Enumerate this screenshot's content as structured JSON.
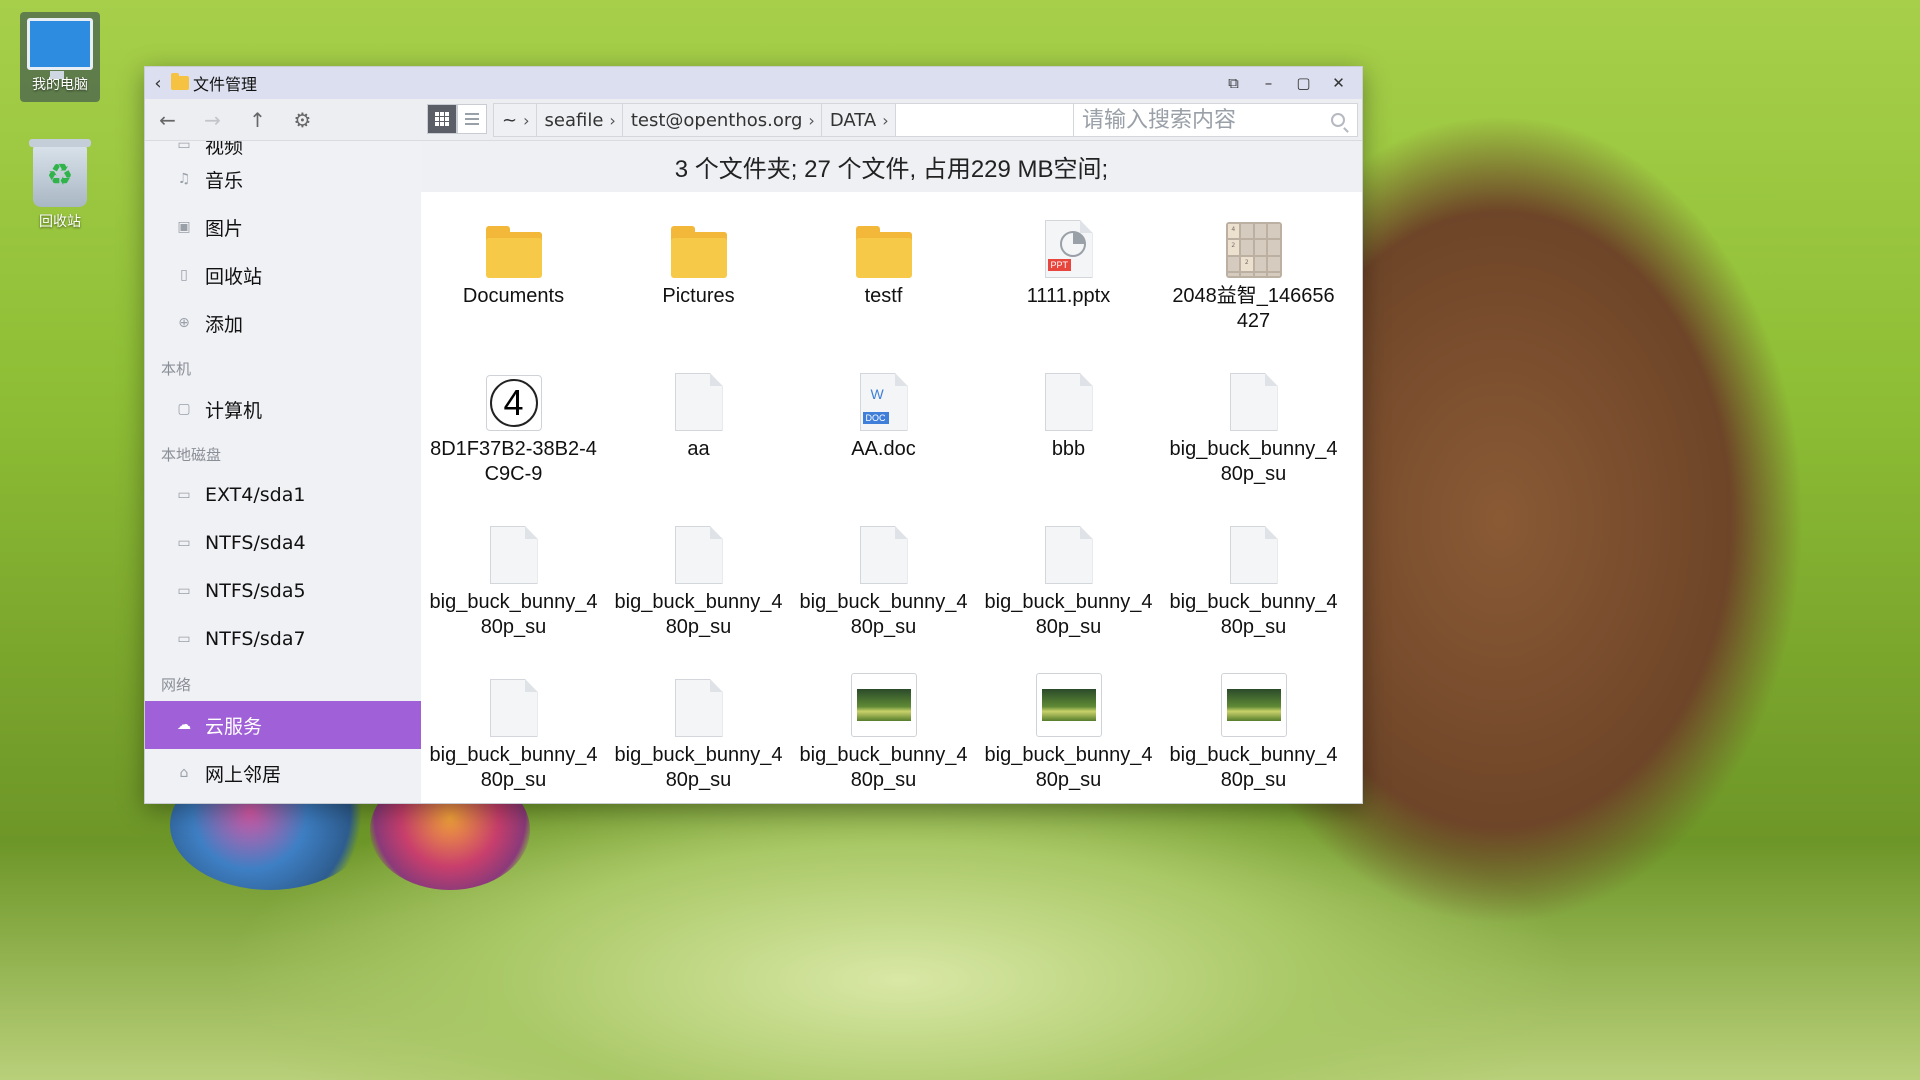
{
  "desktop": {
    "icons": [
      {
        "label": "我的电脑"
      },
      {
        "label": "回收站"
      }
    ]
  },
  "window": {
    "title": "文件管理",
    "controls": {
      "pin": "⧉",
      "minimize": "–",
      "maximize": "▢",
      "close": "✕"
    }
  },
  "toolbar": {
    "back": "←",
    "forward": "→",
    "up": "↑",
    "settings": "⚙",
    "breadcrumb": [
      "~",
      "seafile",
      "test@openthos.org",
      "DATA"
    ],
    "search_placeholder": "请输入搜索内容"
  },
  "sidebar": {
    "items_top": [
      {
        "label": "视频",
        "icon": "video-icon"
      },
      {
        "label": "音乐",
        "icon": "music-icon"
      },
      {
        "label": "图片",
        "icon": "image-icon"
      },
      {
        "label": "回收站",
        "icon": "trash-icon"
      },
      {
        "label": "添加",
        "icon": "add-icon"
      }
    ],
    "section_local": "本机",
    "items_local": [
      {
        "label": "计算机",
        "icon": "computer-icon"
      }
    ],
    "section_disks": "本地磁盘",
    "disks": [
      {
        "label": "EXT4/sda1"
      },
      {
        "label": "NTFS/sda4"
      },
      {
        "label": "NTFS/sda5"
      },
      {
        "label": "NTFS/sda7"
      }
    ],
    "section_network": "网络",
    "network": [
      {
        "label": "云服务",
        "icon": "cloud-icon"
      },
      {
        "label": "网上邻居",
        "icon": "network-icon"
      }
    ]
  },
  "status": "3 个文件夹;  27 个文件, 占用229 MB空间;",
  "files": [
    {
      "name": "Documents",
      "type": "folder"
    },
    {
      "name": "Pictures",
      "type": "folder"
    },
    {
      "name": "testf",
      "type": "folder"
    },
    {
      "name": "1111.pptx",
      "type": "ppt",
      "badge": "PPT"
    },
    {
      "name": "2048益智_146656427",
      "type": "app-2048"
    },
    {
      "name": "8D1F37B2-38B2-4C9C-9",
      "type": "app-4",
      "glyph": "4"
    },
    {
      "name": "aa",
      "type": "file"
    },
    {
      "name": "AA.doc",
      "type": "doc",
      "badge": "DOC",
      "mark": "W"
    },
    {
      "name": "bbb",
      "type": "file"
    },
    {
      "name": "big_buck_bunny_480p_su",
      "type": "file"
    },
    {
      "name": "big_buck_bunny_480p_su",
      "type": "file"
    },
    {
      "name": "big_buck_bunny_480p_su",
      "type": "file"
    },
    {
      "name": "big_buck_bunny_480p_su",
      "type": "file"
    },
    {
      "name": "big_buck_bunny_480p_su",
      "type": "file"
    },
    {
      "name": "big_buck_bunny_480p_su",
      "type": "file"
    },
    {
      "name": "big_buck_bunny_480p_su",
      "type": "file"
    },
    {
      "name": "big_buck_bunny_480p_su",
      "type": "file"
    },
    {
      "name": "big_buck_bunny_480p_su",
      "type": "image"
    },
    {
      "name": "big_buck_bunny_480p_su",
      "type": "image"
    },
    {
      "name": "big_buck_bunny_480p_su",
      "type": "image"
    }
  ],
  "tiles_2048": [
    "4",
    "",
    "",
    "",
    "2",
    "",
    "",
    "",
    "",
    "2",
    "",
    "",
    "",
    "",
    "",
    ""
  ]
}
